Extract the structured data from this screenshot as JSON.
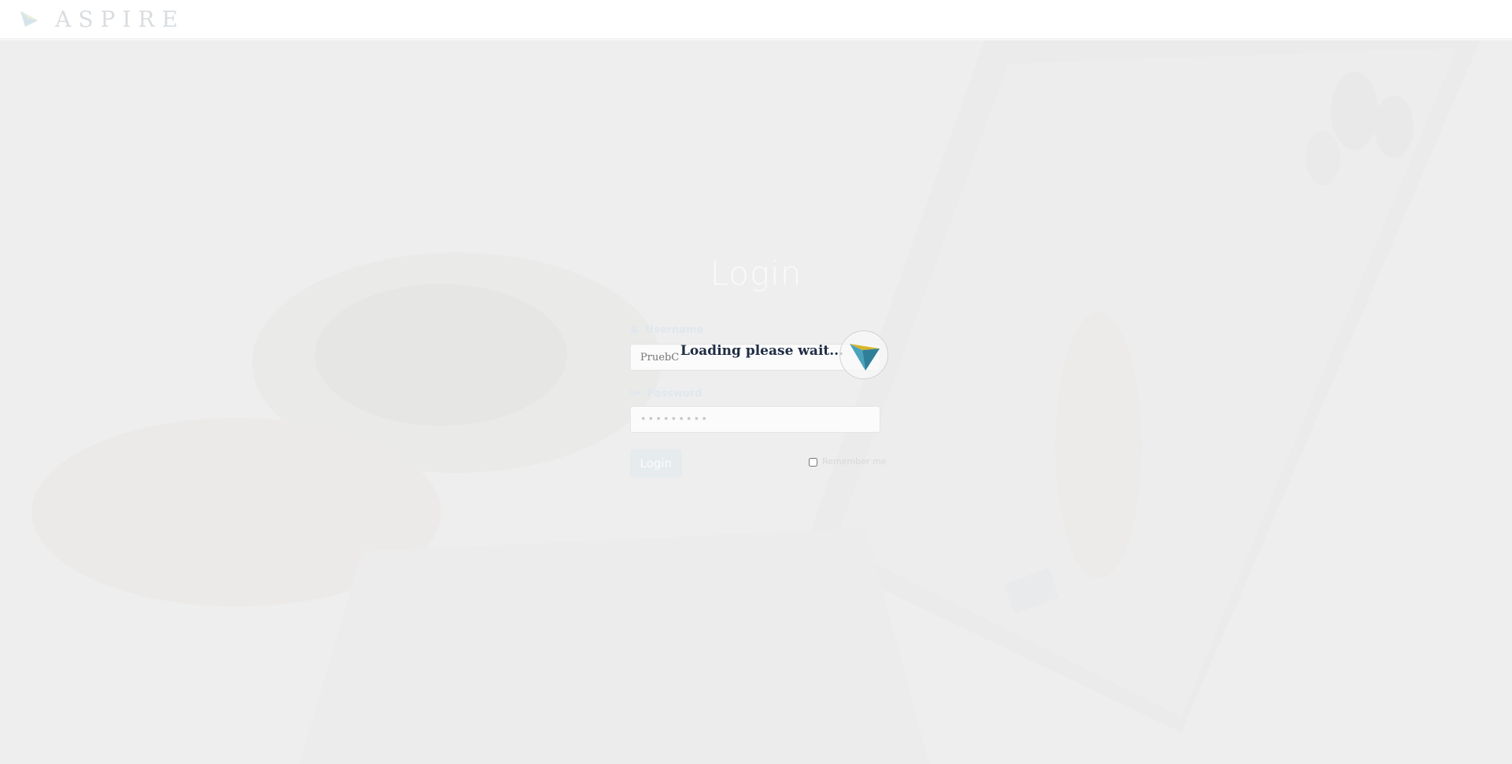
{
  "header": {
    "brand": "ASPIRE",
    "logo_icon": "aspire-logo-icon"
  },
  "login": {
    "title": "Login",
    "username_label": "Username",
    "username_icon": "user-icon",
    "username_placeholder": "PruebC",
    "password_label": "Password",
    "password_icon": "key-icon",
    "password_value": "•••••••••",
    "login_button": "Login",
    "remember_label": "Remember me"
  },
  "overlay": {
    "loading_text": "Loading please wait...",
    "spinner_icon": "triangle-logo-spinner-icon"
  },
  "colors": {
    "brand_teal": "#3a8fa6",
    "brand_yellow": "#d8b52a",
    "loading_text": "#1f2d44"
  }
}
